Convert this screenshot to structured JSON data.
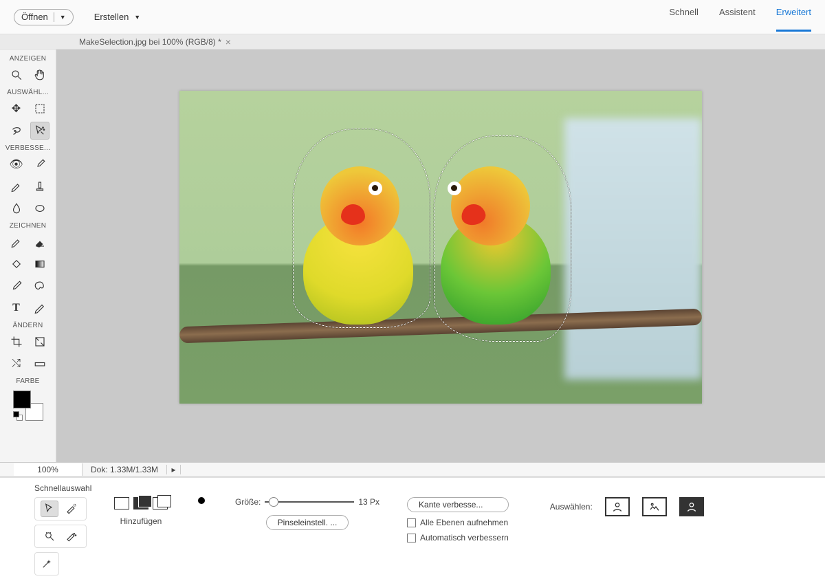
{
  "topbar": {
    "open_label": "Öffnen",
    "create_label": "Erstellen"
  },
  "modes": {
    "quick": "Schnell",
    "guided": "Assistent",
    "expert": "Erweitert"
  },
  "file_tab": "MakeSelection.jpg bei 100% (RGB/8) *",
  "toolbar": {
    "view": "ANZEIGEN",
    "select": "AUSWÄHL...",
    "enhance": "VERBESSE...",
    "draw": "ZEICHNEN",
    "modify": "ÄNDERN",
    "color": "FARBE"
  },
  "status": {
    "zoom": "100%",
    "doc": "Dok: 1.33M/1.33M"
  },
  "options": {
    "title": "Schnellauswahl",
    "add_mode": "Hinzufügen",
    "size_label": "Größe:",
    "size_value": "13 Px",
    "brush_settings": "Pinseleinstell. ...",
    "refine_edge": "Kante verbesse...",
    "all_layers": "Alle Ebenen aufnehmen",
    "auto_enhance": "Automatisch verbessern",
    "select_label": "Auswählen:"
  }
}
